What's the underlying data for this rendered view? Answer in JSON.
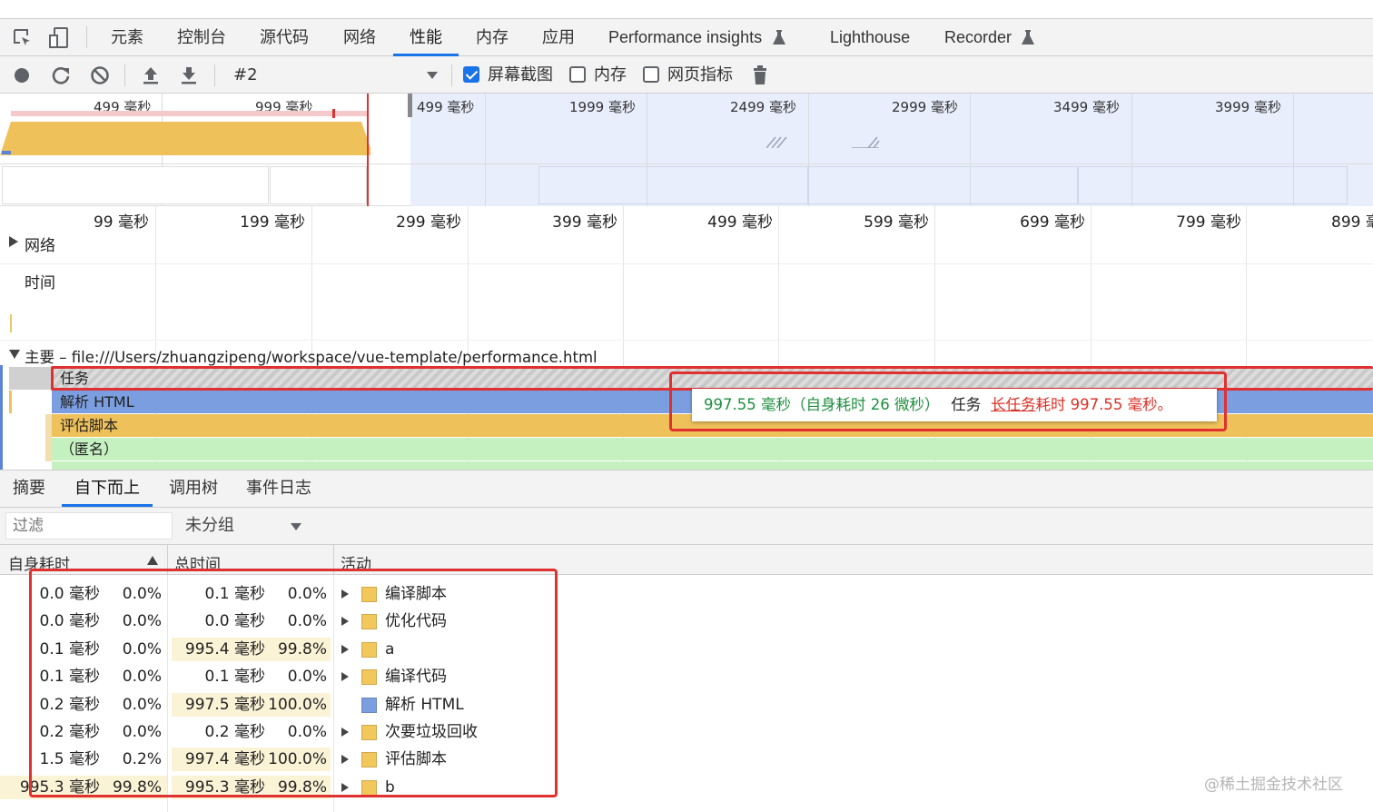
{
  "tabs": [
    "元素",
    "控制台",
    "源代码",
    "网络",
    "性能",
    "内存",
    "应用",
    "Performance insights",
    "Lighthouse",
    "Recorder"
  ],
  "active_tab": "性能",
  "toolbar": {
    "profile": "#2",
    "screenshot_label": "屏幕截图",
    "screenshot_checked": true,
    "memory_label": "内存",
    "memory_checked": false,
    "webvitals_label": "网页指标",
    "webvitals_checked": false
  },
  "overview_ticks": [
    "499 毫秒",
    "999 毫秒",
    "499 毫秒",
    "1999 毫秒",
    "2499 毫秒",
    "2999 毫秒",
    "3499 毫秒",
    "3999 毫秒"
  ],
  "ruler_ticks": [
    "99 毫秒",
    "199 毫秒",
    "299 毫秒",
    "399 毫秒",
    "499 毫秒",
    "599 毫秒",
    "699 毫秒",
    "799 毫秒",
    "899 毫"
  ],
  "tracks": {
    "network": "网络",
    "timings": "时间",
    "main": "主要 – file:///Users/zhuangzipeng/workspace/vue-template/performance.html"
  },
  "flame": [
    "任务",
    "解析 HTML",
    "评估脚本",
    "（匿名）"
  ],
  "tooltip": {
    "duration": "997.55 毫秒（自身耗时 26 微秒）",
    "task": "任务",
    "link": "长任务",
    "tail": "耗时 997.55 毫秒。"
  },
  "bottom_tabs": [
    "摘要",
    "自下而上",
    "调用树",
    "事件日志"
  ],
  "active_bottom_tab": "自下而上",
  "filter": {
    "placeholder": "过滤",
    "group": "未分组"
  },
  "columns": {
    "self": "自身耗时",
    "total": "总时间",
    "activity": "活动"
  },
  "rows": [
    {
      "self": "0.0 毫秒",
      "self_pct": "0.0%",
      "total": "0.1 毫秒",
      "total_pct": "0.0%",
      "activity": "编译脚本",
      "color": "#f2c75c",
      "expand": true
    },
    {
      "self": "0.0 毫秒",
      "self_pct": "0.0%",
      "total": "0.0 毫秒",
      "total_pct": "0.0%",
      "activity": "优化代码",
      "color": "#f2c75c",
      "expand": true
    },
    {
      "self": "0.1 毫秒",
      "self_pct": "0.0%",
      "total": "995.4 毫秒",
      "total_pct": "99.8%",
      "activity": "a",
      "color": "#f2c75c",
      "expand": true
    },
    {
      "self": "0.1 毫秒",
      "self_pct": "0.0%",
      "total": "0.1 毫秒",
      "total_pct": "0.0%",
      "activity": "编译代码",
      "color": "#f2c75c",
      "expand": true
    },
    {
      "self": "0.2 毫秒",
      "self_pct": "0.0%",
      "total": "997.5 毫秒",
      "total_pct": "100.0%",
      "activity": "解析 HTML",
      "color": "#7b9ee0",
      "expand": false
    },
    {
      "self": "0.2 毫秒",
      "self_pct": "0.0%",
      "total": "0.2 毫秒",
      "total_pct": "0.0%",
      "activity": "次要垃圾回收",
      "color": "#f2c75c",
      "expand": true
    },
    {
      "self": "1.5 毫秒",
      "self_pct": "0.2%",
      "total": "997.4 毫秒",
      "total_pct": "100.0%",
      "activity": "评估脚本",
      "color": "#f2c75c",
      "expand": true
    },
    {
      "self": "995.3 毫秒",
      "self_pct": "99.8%",
      "total": "995.3 毫秒",
      "total_pct": "99.8%",
      "activity": "b",
      "color": "#f2c75c",
      "expand": true
    }
  ],
  "watermark": "@稀土掘金技术社区"
}
